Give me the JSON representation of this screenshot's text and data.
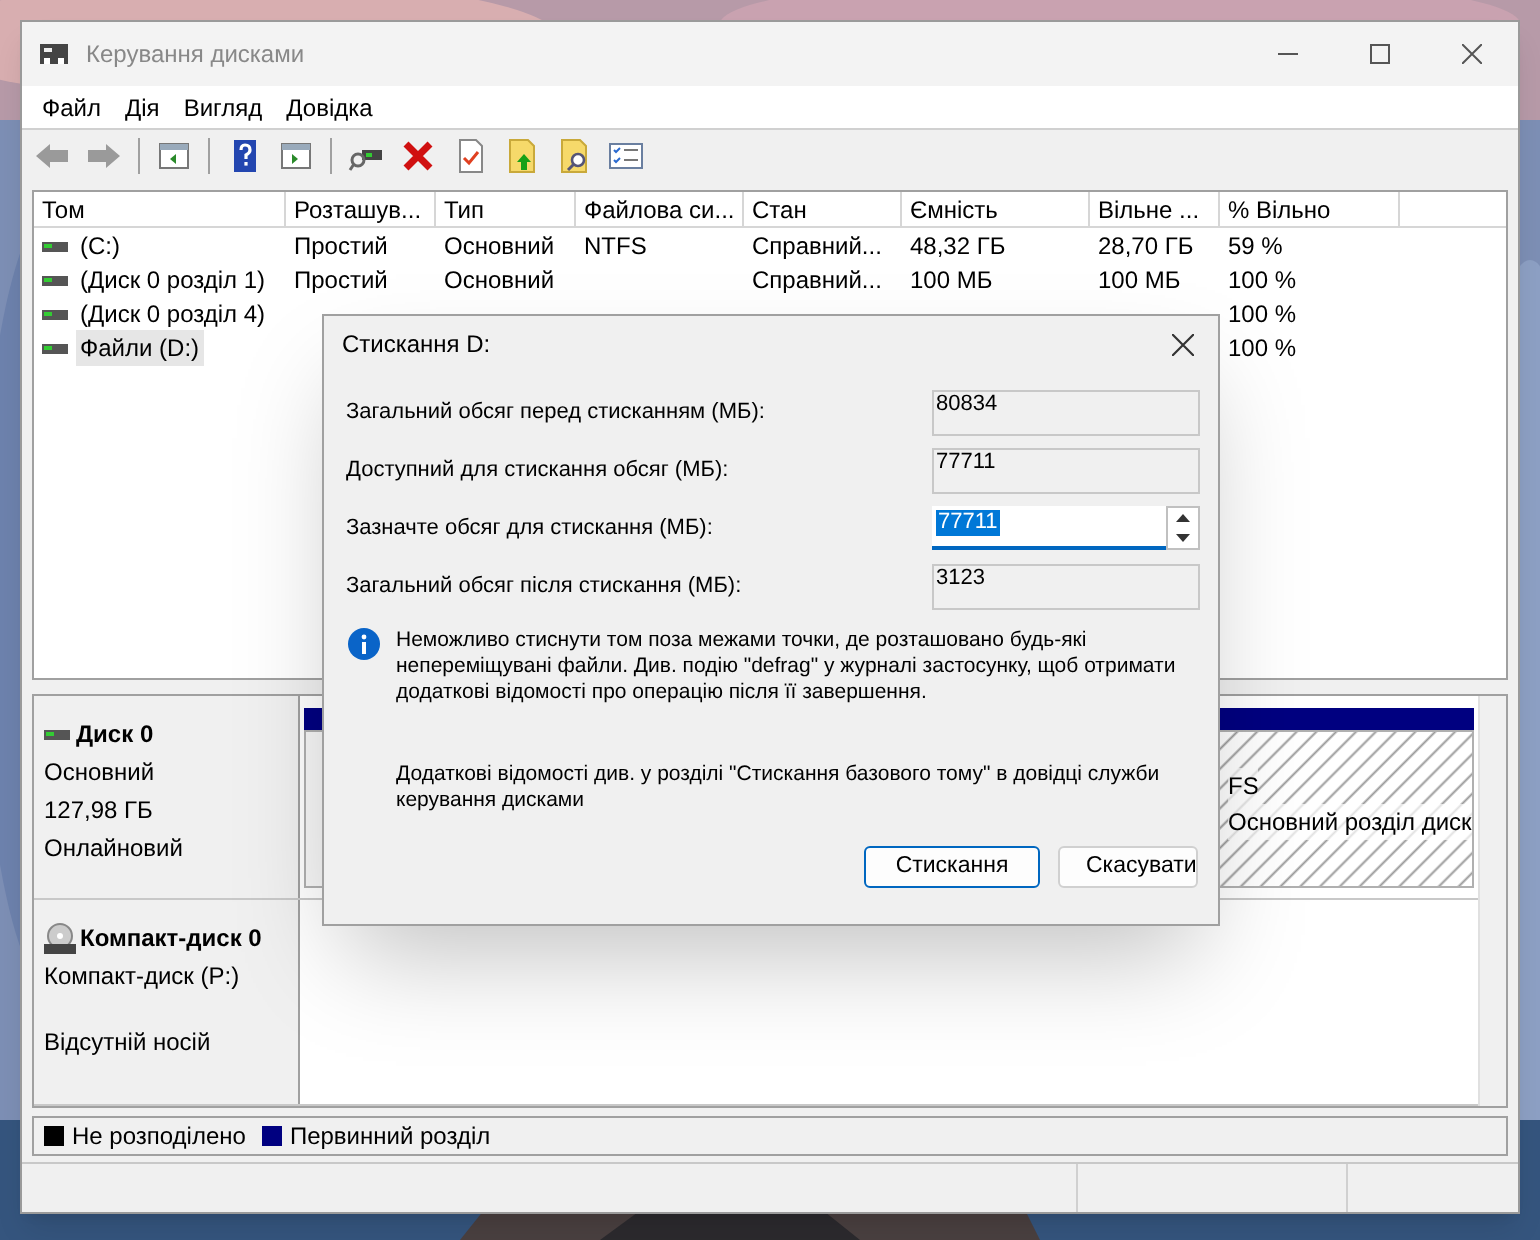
{
  "window": {
    "title": "Керування дисками"
  },
  "menu": [
    "Файл",
    "Дія",
    "Вигляд",
    "Довідка"
  ],
  "volume_table": {
    "columns": [
      "Том",
      "Розташув...",
      "Тип",
      "Файлова си...",
      "Стан",
      "Ємність",
      "Вільне ...",
      "% Вільно"
    ],
    "rows": [
      {
        "volume": "(C:)",
        "layout": "Простий",
        "type": "Основний",
        "file_system": "NTFS",
        "status": "Справний...",
        "capacity": "48,32 ГБ",
        "free": "28,70 ГБ",
        "percent_free": "59 %",
        "selected": false
      },
      {
        "volume": "(Диск 0 розділ 1)",
        "layout": "Простий",
        "type": "Основний",
        "status": "Справний...",
        "capacity": "100 МБ",
        "free": "100 МБ",
        "percent_free": "100 %",
        "selected": false
      },
      {
        "volume": "(Диск 0 розділ 4)",
        "percent_free": "100 %",
        "selected": false
      },
      {
        "volume": "Файли (D:)",
        "percent_free": "100 %",
        "selected": true
      }
    ]
  },
  "disks": [
    {
      "kind": "disk",
      "name": "Диск 0",
      "lines": [
        "Основний",
        "127,98 ГБ",
        "Онлайновий"
      ],
      "partitions": [
        {
          "selected": false
        },
        {
          "lines": [
            "FS",
            "Основний розділ диск"
          ],
          "selected": true
        }
      ]
    },
    {
      "kind": "cdrom",
      "name": "Компакт-диск 0",
      "lines": [
        "Компакт-диск (P:)",
        "Відсутній носій"
      ]
    }
  ],
  "legend": [
    {
      "label": "Не розподілено",
      "color": "#000000"
    },
    {
      "label": "Первинний розділ",
      "color": "#000080"
    }
  ],
  "dialog": {
    "title": "Стискання D:",
    "fields": [
      {
        "kind": "readonly",
        "label": "Загальний обсяг перед стисканням (МБ):",
        "value": "80834"
      },
      {
        "kind": "readonly",
        "label": "Доступний для стискання обсяг (МБ):",
        "value": "77711"
      },
      {
        "kind": "spin",
        "label": "Зазначте обсяг для стискання (МБ):",
        "value": "77711"
      },
      {
        "kind": "readonly",
        "label": "Загальний обсяг після стискання (МБ):",
        "value": "3123"
      }
    ],
    "info": "Неможливо стиснути том поза межами точки, де розташовано будь-які непереміщувані файли. Див. подію \"defrag\" у журналі застосунку, щоб отримати додаткові відомості про операцію після її завершення.",
    "help": "Додаткові відомості див. у розділі \"Стискання базового тому\" в довідці служби керування дисками",
    "buttons": [
      {
        "label": "Стискання",
        "default": true
      },
      {
        "label": "Скасувати",
        "default": false
      }
    ]
  }
}
